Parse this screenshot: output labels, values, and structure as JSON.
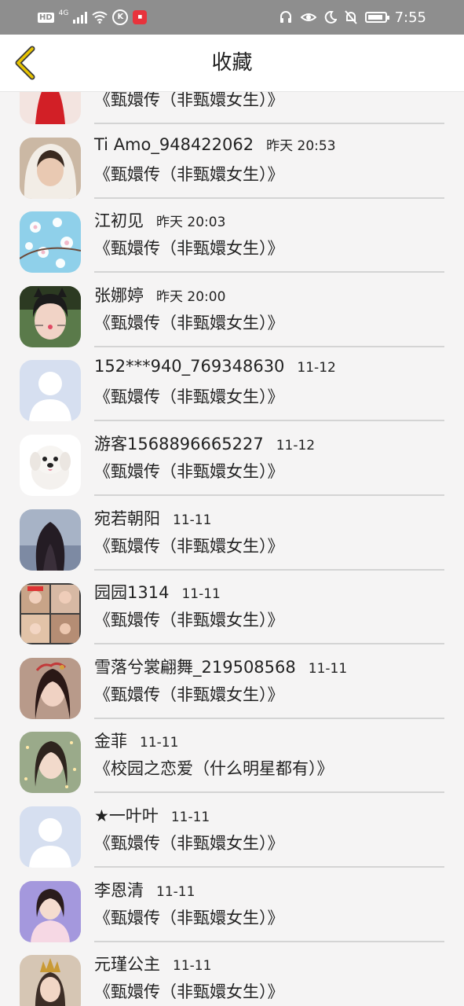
{
  "status_bar": {
    "network": "4G",
    "time": "7:55"
  },
  "header": {
    "title": "收藏"
  },
  "favorites": [
    {
      "name": "",
      "time": "",
      "work": "《甄嬛传（非甄嬛女生）》",
      "avatar": "red-costume-photo"
    },
    {
      "name": "Ti Amo_948422062",
      "time": "昨天 20:53",
      "work": "《甄嬛传（非甄嬛女生）》",
      "avatar": "girl-hood-photo"
    },
    {
      "name": "江初见",
      "time": "昨天 20:03",
      "work": "《甄嬛传（非甄嬛女生）》",
      "avatar": "blossom-photo"
    },
    {
      "name": "张娜婷",
      "time": "昨天 20:00",
      "work": "《甄嬛传（非甄嬛女生）》",
      "avatar": "girl-cat-filter-photo"
    },
    {
      "name": "152***940_769348630",
      "time": "11-12",
      "work": "《甄嬛传（非甄嬛女生）》",
      "avatar": "default-avatar"
    },
    {
      "name": "游客1568896665227",
      "time": "11-12",
      "work": "《甄嬛传（非甄嬛女生）》",
      "avatar": "white-puppy-photo"
    },
    {
      "name": "宛若朝阳",
      "time": "11-11",
      "work": "《甄嬛传（非甄嬛女生）》",
      "avatar": "dark-hair-girl-photo"
    },
    {
      "name": "园园1314",
      "time": "11-11",
      "work": "《甄嬛传（非甄嬛女生）》",
      "avatar": "collage-photo"
    },
    {
      "name": "雪落兮裳翩舞_219508568",
      "time": "11-11",
      "work": "《甄嬛传（非甄嬛女生）》",
      "avatar": "ancient-costume-photo"
    },
    {
      "name": "金菲",
      "time": "11-11",
      "work": "《校园之恋爱（什么明星都有）》",
      "avatar": "girl-lights-photo"
    },
    {
      "name": "★一叶叶",
      "time": "11-11",
      "work": "《甄嬛传（非甄嬛女生）》",
      "avatar": "default-avatar"
    },
    {
      "name": "李恩清",
      "time": "11-11",
      "work": "《甄嬛传（非甄嬛女生）》",
      "avatar": "girl-pink-photo"
    },
    {
      "name": "元瑾公主",
      "time": "11-11",
      "work": "《甄嬛传（非甄嬛女生）》",
      "avatar": "crown-costume-photo"
    }
  ],
  "colors": {
    "status_bar": "#8e8e8e",
    "header_bg": "#ffffff",
    "page_bg": "#f5f4f4",
    "back_arrow": "#e8c400",
    "divider": "#d4d4d4",
    "default_avatar_bg": "#d6dff0"
  }
}
